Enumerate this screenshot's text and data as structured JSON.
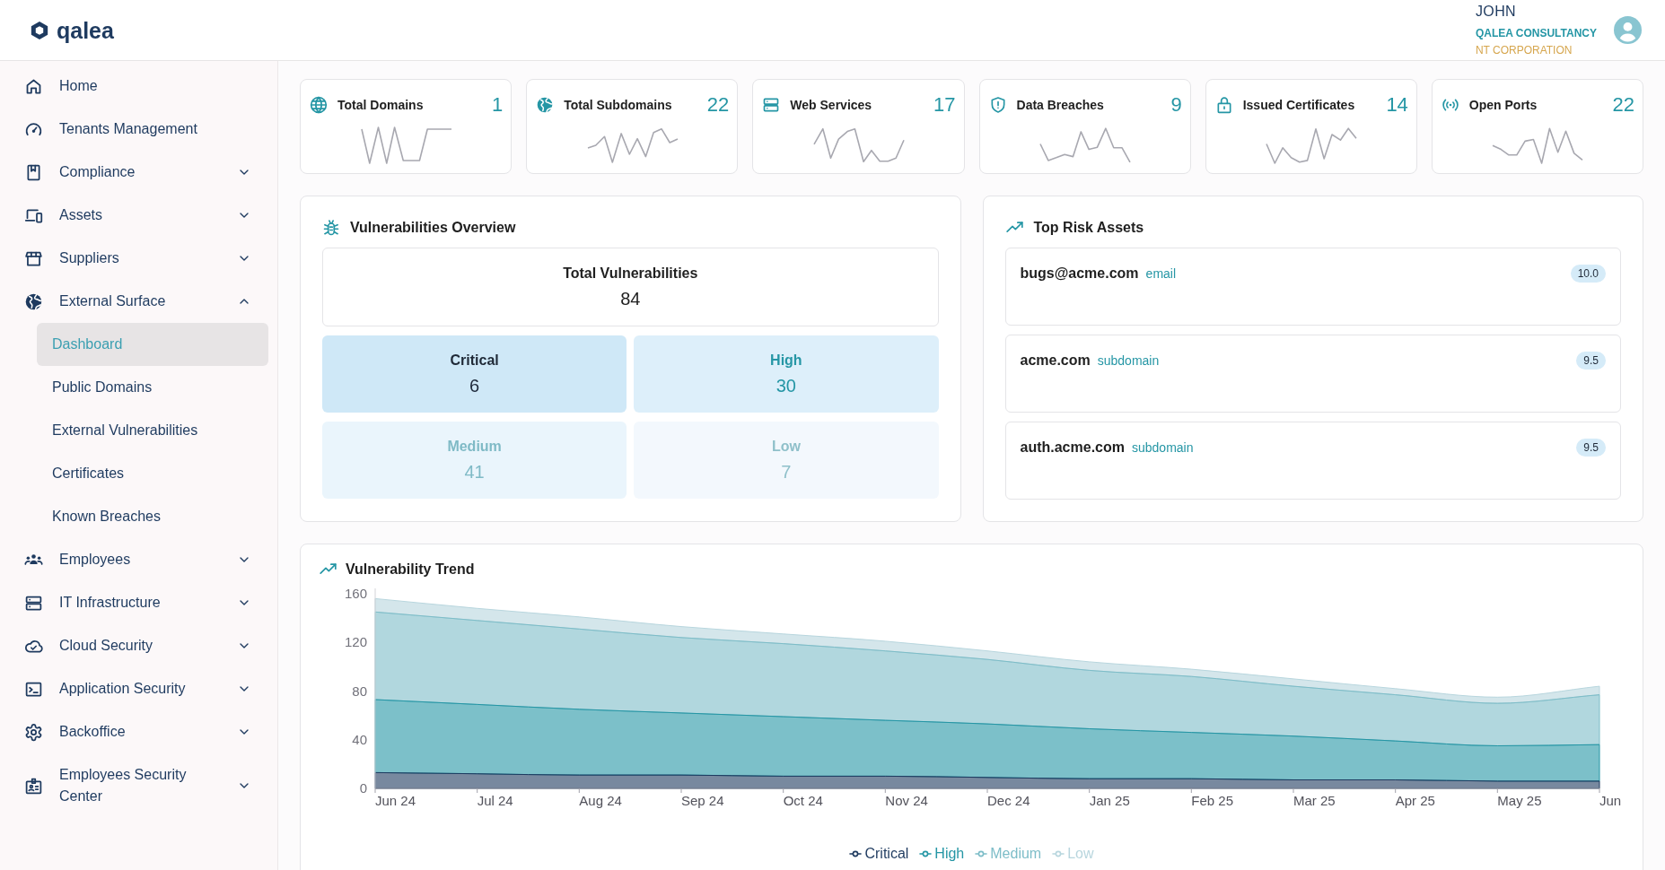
{
  "header": {
    "logo": "qalea",
    "user": {
      "name": "JOHN",
      "organization": "QALEA CONSULTANCY",
      "tenant": "NT CORPORATION"
    }
  },
  "sidebar": {
    "items": [
      {
        "label": "Home",
        "selected": false
      },
      {
        "label": "Tenants Management",
        "selected": false
      },
      {
        "label": "Compliance",
        "selected": false,
        "expanded": false
      },
      {
        "label": "Assets",
        "selected": false,
        "expanded": false
      },
      {
        "label": "Suppliers",
        "selected": false,
        "expanded": false
      },
      {
        "label": "External Surface",
        "selected": false,
        "expanded": true,
        "children": [
          {
            "label": "Dashboard",
            "selected": true
          },
          {
            "label": "Public Domains",
            "selected": false
          },
          {
            "label": "External Vulnerabilities",
            "selected": false
          },
          {
            "label": "Certificates",
            "selected": false
          },
          {
            "label": "Known Breaches",
            "selected": false
          }
        ]
      },
      {
        "label": "Employees",
        "selected": false,
        "expanded": false
      },
      {
        "label": "IT Infrastructure",
        "selected": false,
        "expanded": false
      },
      {
        "label": "Cloud Security",
        "selected": false,
        "expanded": false
      },
      {
        "label": "Application Security",
        "selected": false,
        "expanded": false
      },
      {
        "label": "Backoffice",
        "selected": false,
        "expanded": false
      },
      {
        "label": "Employees Security Center",
        "selected": false,
        "expanded": false
      }
    ]
  },
  "stats": [
    {
      "title": "Total Domains",
      "value": "1"
    },
    {
      "title": "Total Subdomains",
      "value": "22"
    },
    {
      "title": "Web Services",
      "value": "17"
    },
    {
      "title": "Data Breaches",
      "value": "9"
    },
    {
      "title": "Issued Certificates",
      "value": "14"
    },
    {
      "title": "Open Ports",
      "value": "22"
    }
  ],
  "overview": {
    "title": "Vulnerabilities Overview",
    "total": {
      "label": "Total Vulnerabilities",
      "value": "84"
    },
    "severities": [
      {
        "kind": "critical",
        "label": "Critical",
        "value": "6"
      },
      {
        "kind": "high",
        "label": "High",
        "value": "30"
      },
      {
        "kind": "medium",
        "label": "Medium",
        "value": "41"
      },
      {
        "kind": "low",
        "label": "Low",
        "value": "7"
      }
    ]
  },
  "top_risk_assets": {
    "title": "Top Risk Assets",
    "items": [
      {
        "name": "bugs@acme.com",
        "type": "email",
        "score": "10.0"
      },
      {
        "name": "acme.com",
        "type": "subdomain",
        "score": "9.5"
      },
      {
        "name": "auth.acme.com",
        "type": "subdomain",
        "score": "9.5"
      }
    ]
  },
  "trend": {
    "title": "Vulnerability Trend",
    "chart_data": [
      {
        "type": "area",
        "stacked": true,
        "categories": [
          "Jun 24",
          "Jul 24",
          "Aug 24",
          "Sep 24",
          "Oct 24",
          "Nov 24",
          "Dec 24",
          "Jan 25",
          "Feb 25",
          "Mar 25",
          "Apr 25",
          "May 25",
          "Jun"
        ],
        "ylim": [
          0,
          160
        ],
        "yticks": [
          0,
          40,
          80,
          120,
          160
        ],
        "legend": "bottom",
        "series": [
          {
            "name": "Critical",
            "color": "#1e3a5f",
            "values": [
              13,
              12,
              11,
              11,
              10,
              10,
              9,
              8,
              8,
              7,
              7,
              6,
              6
            ]
          },
          {
            "name": "High",
            "color": "#2596a5",
            "values": [
              60,
              57,
              54,
              51,
              49,
              46,
              44,
              41,
              38,
              36,
              32,
              29,
              30
            ]
          },
          {
            "name": "Medium",
            "color": "#7dbdc8",
            "values": [
              72,
              69,
              66,
              62,
              60,
              57,
              53,
              48,
              46,
              41,
              38,
              35,
              41
            ]
          },
          {
            "name": "Low",
            "color": "#b8d6de",
            "values": [
              11,
              10,
              10,
              9,
              8,
              8,
              7,
              7,
              6,
              6,
              5,
              5,
              7
            ]
          }
        ]
      }
    ]
  }
}
